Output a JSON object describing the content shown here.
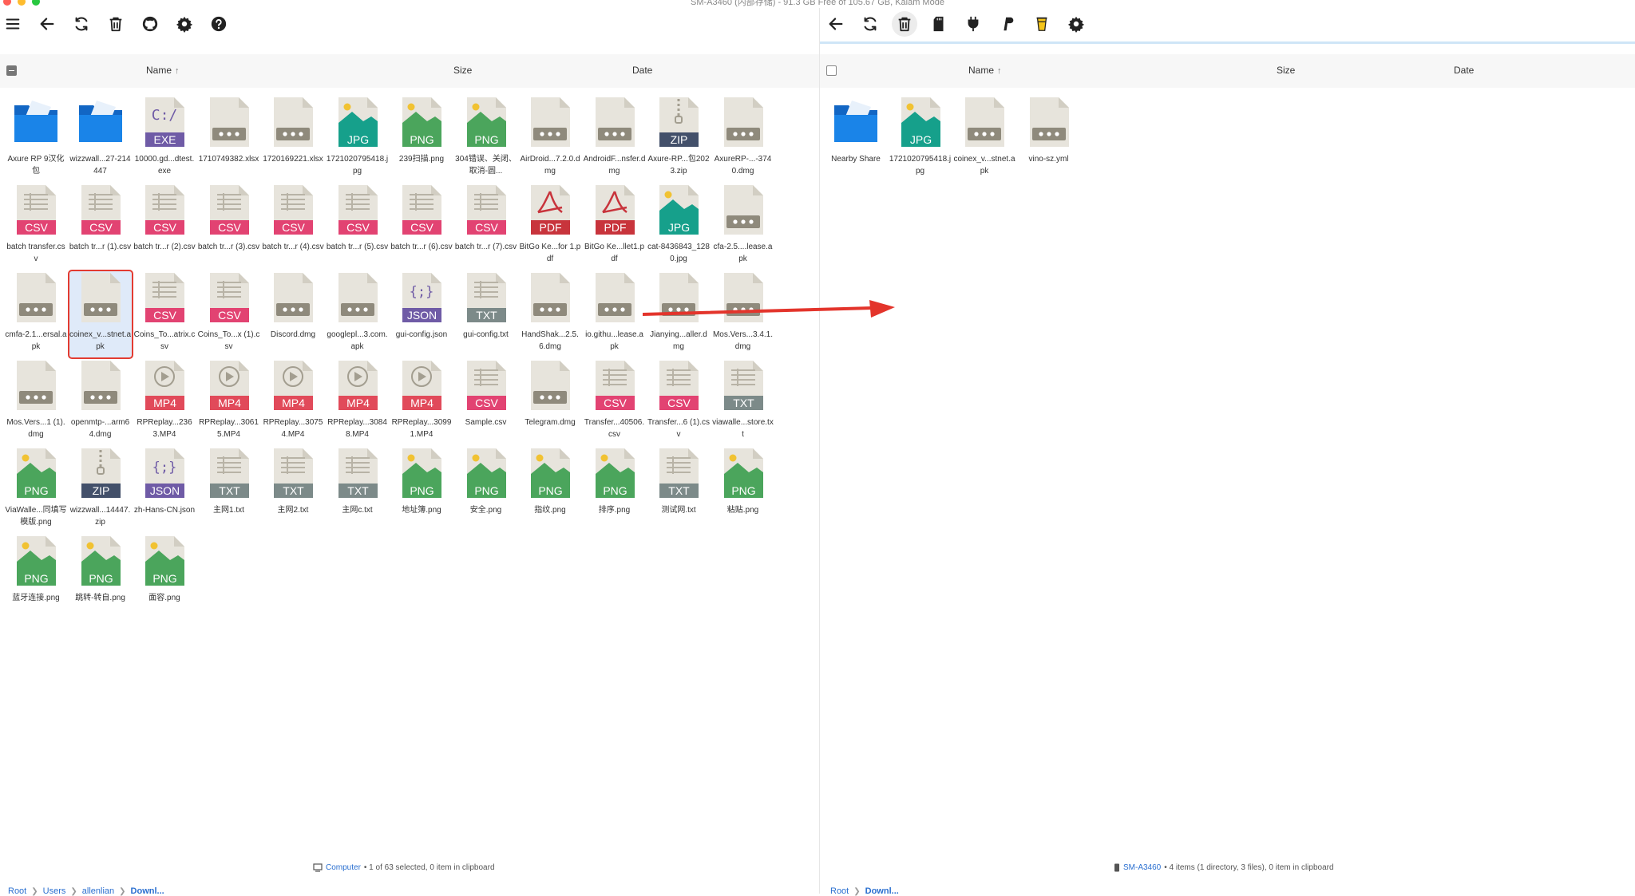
{
  "window": {
    "title": "SM-A3460 (内部存储) - 91.3 GB Free of 105.67 GB, Kalam Mode"
  },
  "colors": {
    "folder": "#1a84e8",
    "exe": "#6f5ba6",
    "csv": "#e24372",
    "pdf": "#c8343c",
    "png": "#4ba55c",
    "jpg": "#16a08b",
    "zip": "#43506a",
    "json": "#6f5ba6",
    "txt": "#7c8a89",
    "mp4": "#e14a5a",
    "generic": "#8f8a7c",
    "link": "#2a6fd0",
    "selection": "#e33b31"
  },
  "left": {
    "toolbar": [
      "menu-icon",
      "back-icon",
      "refresh-icon",
      "trash-icon",
      "github-icon",
      "gear-icon",
      "help-icon"
    ],
    "headers": {
      "name": "Name",
      "size": "Size",
      "date": "Date"
    },
    "files": [
      {
        "name": "Axure RP 9汉化包",
        "type": "folder"
      },
      {
        "name": "wizzwall...27-214447",
        "type": "folder"
      },
      {
        "name": "10000.gd...dtest.exe",
        "type": "exe",
        "label": "EXE"
      },
      {
        "name": "1710749382.xlsx",
        "type": "generic"
      },
      {
        "name": "1720169221.xlsx",
        "type": "generic"
      },
      {
        "name": "1721020795418.jpg",
        "type": "image",
        "label": "JPG"
      },
      {
        "name": "239扫描.png",
        "type": "image",
        "label": "PNG"
      },
      {
        "name": "304错误、关闭、取消-圆...",
        "type": "image",
        "label": "PNG"
      },
      {
        "name": "AirDroid...7.2.0.dmg",
        "type": "generic"
      },
      {
        "name": "AndroidF...nsfer.dmg",
        "type": "generic"
      },
      {
        "name": "Axure-RP...包2023.zip",
        "type": "zip",
        "label": "ZIP"
      },
      {
        "name": "AxureRP-...-3740.dmg",
        "type": "generic"
      },
      {
        "name": "batch transfer.csv",
        "type": "csv",
        "label": "CSV"
      },
      {
        "name": "batch tr...r (1).csv",
        "type": "csv",
        "label": "CSV"
      },
      {
        "name": "batch tr...r (2).csv",
        "type": "csv",
        "label": "CSV"
      },
      {
        "name": "batch tr...r (3).csv",
        "type": "csv",
        "label": "CSV"
      },
      {
        "name": "batch tr...r (4).csv",
        "type": "csv",
        "label": "CSV"
      },
      {
        "name": "batch tr...r (5).csv",
        "type": "csv",
        "label": "CSV"
      },
      {
        "name": "batch tr...r (6).csv",
        "type": "csv",
        "label": "CSV"
      },
      {
        "name": "batch tr...r (7).csv",
        "type": "csv",
        "label": "CSV"
      },
      {
        "name": "BitGo Ke...for 1.pdf",
        "type": "pdf",
        "label": "PDF"
      },
      {
        "name": "BitGo Ke...llet1.pdf",
        "type": "pdf",
        "label": "PDF"
      },
      {
        "name": "cat-8436843_1280.jpg",
        "type": "image",
        "label": "JPG"
      },
      {
        "name": "cfa-2.5....lease.apk",
        "type": "generic"
      },
      {
        "name": "cmfa-2.1...ersal.apk",
        "type": "generic"
      },
      {
        "name": "coinex_v...stnet.apk",
        "type": "generic",
        "selected": true
      },
      {
        "name": "Coins_To...atrix.csv",
        "type": "csv",
        "label": "CSV"
      },
      {
        "name": "Coins_To...x (1).csv",
        "type": "csv",
        "label": "CSV"
      },
      {
        "name": "Discord.dmg",
        "type": "generic"
      },
      {
        "name": "googlepl...3.com.apk",
        "type": "generic"
      },
      {
        "name": "gui-config.json",
        "type": "json",
        "label": "JSON"
      },
      {
        "name": "gui-config.txt",
        "type": "txt",
        "label": "TXT"
      },
      {
        "name": "HandShak...2.5.6.dmg",
        "type": "generic"
      },
      {
        "name": "io.githu...lease.apk",
        "type": "generic"
      },
      {
        "name": "Jianying...aller.dmg",
        "type": "generic"
      },
      {
        "name": "Mos.Vers...3.4.1.dmg",
        "type": "generic"
      },
      {
        "name": "Mos.Vers...1 (1).dmg",
        "type": "generic"
      },
      {
        "name": "openmtp-...arm64.dmg",
        "type": "generic"
      },
      {
        "name": "RPReplay...236 3.MP4",
        "type": "mp4",
        "label": "MP4"
      },
      {
        "name": "RPReplay...30615.MP4",
        "type": "mp4",
        "label": "MP4"
      },
      {
        "name": "RPReplay...30754.MP4",
        "type": "mp4",
        "label": "MP4"
      },
      {
        "name": "RPReplay...30848.MP4",
        "type": "mp4",
        "label": "MP4"
      },
      {
        "name": "RPReplay...30991.MP4",
        "type": "mp4",
        "label": "MP4"
      },
      {
        "name": "Sample.csv",
        "type": "csv",
        "label": "CSV"
      },
      {
        "name": "Telegram.dmg",
        "type": "generic"
      },
      {
        "name": "Transfer...40506.csv",
        "type": "csv",
        "label": "CSV"
      },
      {
        "name": "Transfer...6 (1).csv",
        "type": "csv",
        "label": "CSV"
      },
      {
        "name": "viawalle...store.txt",
        "type": "txt",
        "label": "TXT"
      },
      {
        "name": "ViaWalle...同填写模版.png",
        "type": "image",
        "label": "PNG"
      },
      {
        "name": "wizzwall...14447.zip",
        "type": "zip",
        "label": "ZIP"
      },
      {
        "name": "zh-Hans-CN.json",
        "type": "json",
        "label": "JSON"
      },
      {
        "name": "主网1.txt",
        "type": "txt",
        "label": "TXT"
      },
      {
        "name": "主网2.txt",
        "type": "txt",
        "label": "TXT"
      },
      {
        "name": "主网c.txt",
        "type": "txt",
        "label": "TXT"
      },
      {
        "name": "地址簿.png",
        "type": "image",
        "label": "PNG"
      },
      {
        "name": "安全.png",
        "type": "image",
        "label": "PNG"
      },
      {
        "name": "指纹.png",
        "type": "image",
        "label": "PNG"
      },
      {
        "name": "排序.png",
        "type": "image",
        "label": "PNG"
      },
      {
        "name": "测试网.txt",
        "type": "txt",
        "label": "TXT"
      },
      {
        "name": "粘贴.png",
        "type": "image",
        "label": "PNG"
      },
      {
        "name": "蓝牙连接.png",
        "type": "image",
        "label": "PNG"
      },
      {
        "name": "跳转-转自.png",
        "type": "image",
        "label": "PNG"
      },
      {
        "name": "面容.png",
        "type": "image",
        "label": "PNG"
      }
    ],
    "status": {
      "device": "Computer",
      "text": "• 1 of 63 selected, 0 item in clipboard"
    },
    "breadcrumb": [
      "Root",
      "Users",
      "allenlian",
      "Downl..."
    ]
  },
  "right": {
    "toolbar": [
      "back-icon",
      "refresh-icon",
      "trash-icon",
      "sdcard-icon",
      "plug-icon",
      "paypal-icon",
      "cup-icon",
      "gear-icon"
    ],
    "headers": {
      "name": "Name",
      "size": "Size",
      "date": "Date"
    },
    "files": [
      {
        "name": "Nearby Share",
        "type": "folder"
      },
      {
        "name": "1721020795418.jpg",
        "type": "image",
        "label": "JPG"
      },
      {
        "name": "coinex_v...stnet.apk",
        "type": "generic"
      },
      {
        "name": "vino-sz.yml",
        "type": "generic"
      }
    ],
    "status": {
      "device": "SM-A3460",
      "text": "• 4 items (1 directory, 3 files), 0 item in clipboard"
    },
    "breadcrumb": [
      "Root",
      "Downl..."
    ]
  }
}
